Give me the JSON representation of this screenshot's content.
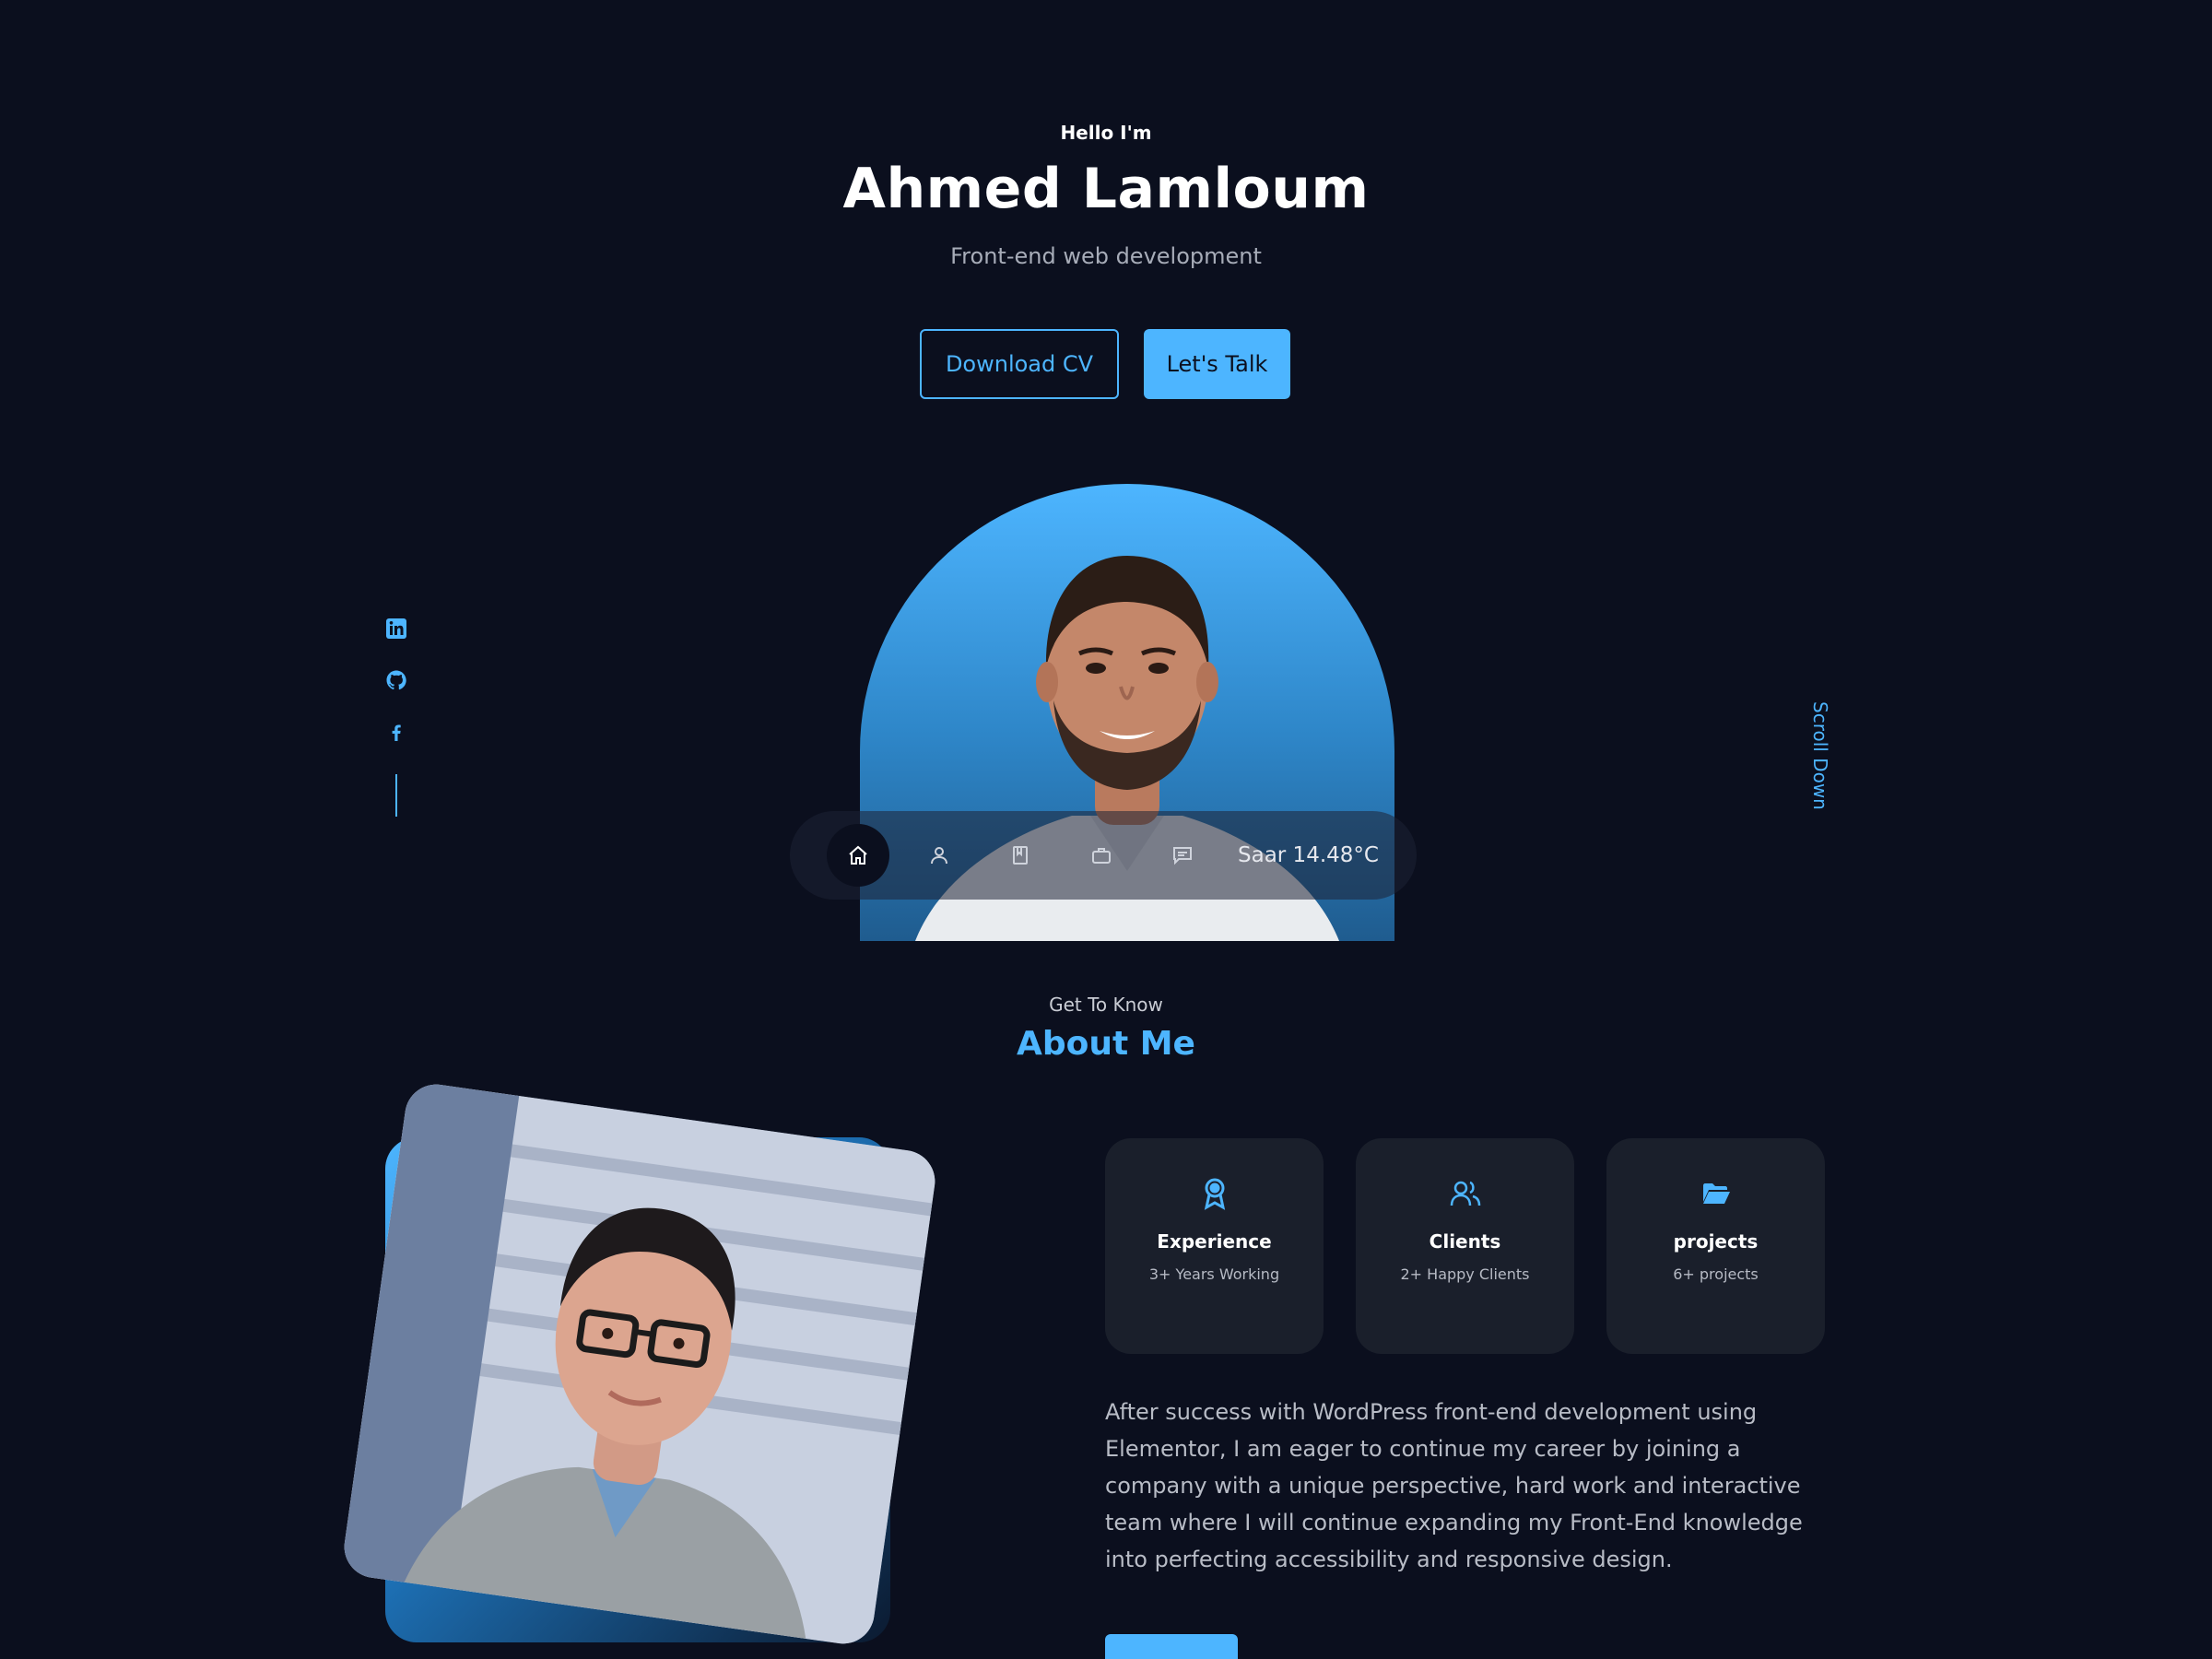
{
  "hero": {
    "greeting": "Hello I'm",
    "name": "Ahmed Lamloum",
    "role": "Front-end web development",
    "buttons": {
      "download_cv": "Download CV",
      "lets_talk": "Let's Talk"
    }
  },
  "socials": [
    {
      "icon": "linkedin-icon"
    },
    {
      "icon": "github-icon"
    },
    {
      "icon": "facebook-icon"
    }
  ],
  "scroll_down": "Scroll Down",
  "floating_nav": {
    "items": [
      {
        "icon": "home-icon",
        "active": true
      },
      {
        "icon": "user-icon",
        "active": false
      },
      {
        "icon": "book-icon",
        "active": false
      },
      {
        "icon": "briefcase-icon",
        "active": false
      },
      {
        "icon": "message-icon",
        "active": false
      }
    ],
    "weather": "Saar 14.48°C"
  },
  "about": {
    "kicker": "Get To Know",
    "title": "About Me",
    "cards": [
      {
        "icon": "award-icon",
        "title": "Experience",
        "subtitle": "3+ Years Working"
      },
      {
        "icon": "users-icon",
        "title": "Clients",
        "subtitle": "2+ Happy Clients"
      },
      {
        "icon": "folder-icon",
        "title": "projects",
        "subtitle": "6+ projects"
      }
    ],
    "description": "After success with WordPress front-end development using Elementor, I am eager to continue my career by joining a company with a unique perspective, hard work and interactive team where I will continue expanding my Front-End knowledge into perfecting accessibility and responsive design."
  },
  "colors": {
    "background": "#0b0f1e",
    "accent": "#4db5ff",
    "card": "#1a1f2b",
    "muted_text": "#b8bcc6"
  }
}
